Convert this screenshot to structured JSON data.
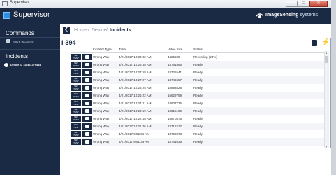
{
  "window": {
    "title": "Supervisor",
    "min": "–",
    "max": "□",
    "close": "✕"
  },
  "header": {
    "brand": "Supervisor",
    "company_bold": "ImageSensing",
    "company_light": " systems"
  },
  "sidebar": {
    "commands_heading": "Commands",
    "save_label": "SAVE INCIDENT",
    "incidents_heading": "Incidents",
    "device_label": "Device ID 118461379444"
  },
  "breadcrumb": {
    "back": "❮",
    "home": "Home",
    "sep1": "/",
    "device": "Device",
    "sep2": "/",
    "incidents": "Incidents"
  },
  "page": {
    "title": "I-394"
  },
  "table": {
    "headers": {
      "type": "Incident Type",
      "time": "Time",
      "size": "Video Size",
      "status": "Status"
    },
    "rows": [
      {
        "btn": "SET TEST",
        "type": "Wrong Way",
        "time": "4/21/2017 10:30:02 AM",
        "size": "4425680",
        "status": "Recording (23%)"
      },
      {
        "btn": "SET TEST",
        "type": "Wrong Way",
        "time": "4/21/2017 10:28:58 AM",
        "size": "18761866",
        "status": "Ready"
      },
      {
        "btn": "SET TEST",
        "type": "Wrong Way",
        "time": "4/21/2017 10:27:58 AM",
        "size": "18725541",
        "status": "Ready"
      },
      {
        "btn": "SET TEST",
        "type": "Wrong Way",
        "time": "4/21/2017 10:27:27 AM",
        "size": "18746557",
        "status": "Ready"
      },
      {
        "btn": "SET TEST",
        "type": "Wrong Way",
        "time": "4/21/2017 10:26:25 AM",
        "size": "18693828",
        "status": "Ready"
      },
      {
        "btn": "SET TEST",
        "type": "Wrong Way",
        "time": "4/21/2017 10:25:22 AM",
        "size": "16629799",
        "status": "Ready"
      },
      {
        "btn": "SET TEST",
        "type": "Wrong Way",
        "time": "4/21/2017 10:24:21 AM",
        "size": "18607735",
        "status": "Ready"
      },
      {
        "btn": "SET TEST",
        "type": "Wrong Way",
        "time": "4/21/2017 10:23:19 AM",
        "size": "18818196",
        "status": "Ready"
      },
      {
        "btn": "SET TEST",
        "type": "Wrong Way",
        "time": "4/21/2017 10:22:18 AM",
        "size": "18670476",
        "status": "Ready"
      },
      {
        "btn": "SET TEST",
        "type": "Wrong Way",
        "time": "4/21/2017 10:21:46 AM",
        "size": "18716217",
        "status": "Ready"
      },
      {
        "btn": "SET TEST",
        "type": "Wrong Way",
        "time": "4/21/2017 9:52:35 AM",
        "size": "18752873",
        "status": "Ready"
      },
      {
        "btn": "SET TEST",
        "type": "Wrong Way",
        "time": "4/21/2017 9:51:33 AM",
        "size": "18741025",
        "status": "Ready"
      }
    ]
  },
  "icons": {
    "save": "save-icon",
    "eye": "eye-logo-icon",
    "disk": "disk-icon",
    "bolt": "bolt-icon",
    "camera": "camera-icon"
  },
  "colors": {
    "navy": "#1b2a44",
    "accent": "#2c8fe0"
  }
}
